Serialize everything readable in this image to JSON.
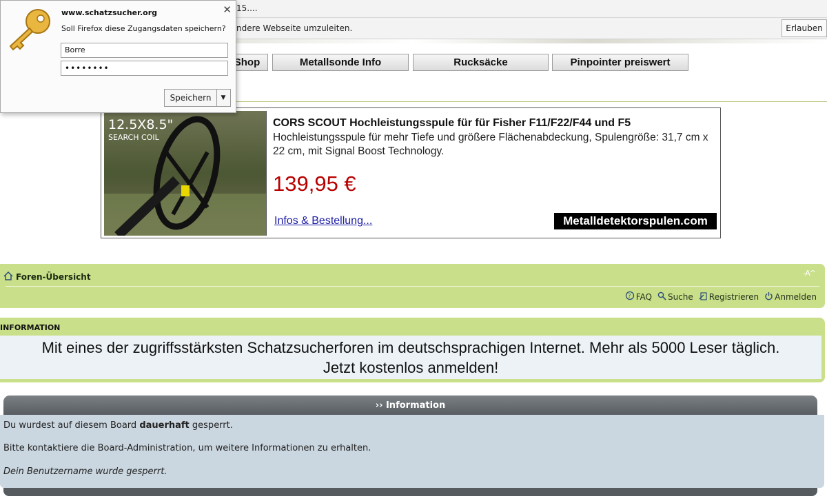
{
  "firefox": {
    "bar1_text": "15....",
    "bar2_text": "ndere Webseite umzuleiten.",
    "allow_button": "Erlauben"
  },
  "password_popup": {
    "site": "www.schatzsucher.org",
    "question": "Soll Firefox diese Zugangsdaten speichern?",
    "username": "Borre",
    "password": "••••••••",
    "save_label": "Speichern",
    "close_glyph": "✕",
    "dropdown_glyph": "▼"
  },
  "top_nav": {
    "items": [
      "Shop",
      "Metallsonde Info",
      "Rucksäcke",
      "Pinpointer preiswert"
    ]
  },
  "ad": {
    "image_text_line1": "12.5X8.5\"",
    "image_text_line2": "SEARCH COIL",
    "title": "CORS SCOUT Hochleistungsspule für für Fisher F11/F22/F44 und F5",
    "description": "Hochleistungsspule für mehr Tiefe und größere Flächenabdeckung, Spulengröße: 31,7 cm x 22 cm, mit Signal Boost Technology.",
    "price": "139,95 €",
    "link": "Infos & Bestellung...",
    "brand": "Metalldetektorspulen.com"
  },
  "navbar": {
    "breadcrumb": "Foren-Übersicht",
    "font_size_control": "-A^",
    "links": {
      "faq": "FAQ",
      "search": "Suche",
      "register": "Registrieren",
      "login": "Anmelden"
    }
  },
  "info_box": {
    "label": "INFORMATION",
    "line1": "Mit eines der zugriffsstärksten Schatzsucherforen im deutschsprachigen Internet. Mehr als 5000 Leser täglich.",
    "line2": "Jetzt kostenlos anmelden!"
  },
  "panel": {
    "title": "›› Information",
    "line1_pre": "Du wurdest auf diesem Board ",
    "line1_bold": "dauerhaft",
    "line1_post": " gesperrt.",
    "line2": "Bitte kontaktiere die Board-Administration, um weitere Informationen zu erhalten.",
    "line3": "Dein Benutzername wurde gesperrt."
  },
  "colors": {
    "navbar_green": "#c9df8a",
    "price_red": "#b80000",
    "panel_body": "#cbd7e0",
    "panel_head": "#5e6368"
  }
}
